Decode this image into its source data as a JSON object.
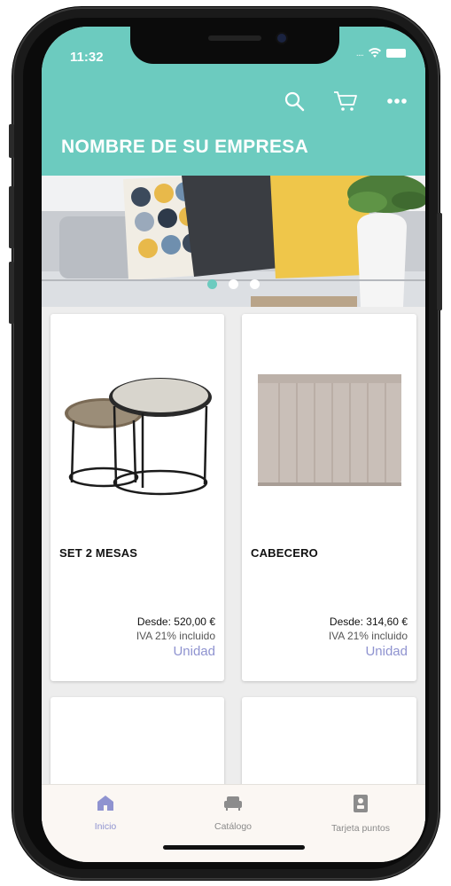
{
  "status": {
    "time": "11:32",
    "signal": "...."
  },
  "header": {
    "company_name": "NOMBRE DE SU EMPRESA",
    "accent": "#6ccbbf"
  },
  "actions": [
    "search-icon",
    "cart-icon",
    "more-icon"
  ],
  "banner": {
    "slides": 3,
    "active_slide": 1
  },
  "products": [
    {
      "name": "SET 2 MESAS",
      "price": "Desde: 520,00 €",
      "iva": "IVA 21% incluido",
      "unit": "Unidad"
    },
    {
      "name": "CABECERO",
      "price": "Desde: 314,60 €",
      "iva": "IVA 21% incluido",
      "unit": "Unidad"
    }
  ],
  "tabs": [
    {
      "label": "Inicio",
      "icon": "home-icon",
      "active": true
    },
    {
      "label": "Catálogo",
      "icon": "sofa-icon",
      "active": false
    },
    {
      "label": "Tarjeta puntos",
      "icon": "points-card-icon",
      "active": false
    }
  ],
  "colors": {
    "accent": "#6ccbbf",
    "link": "#8f93d0"
  }
}
